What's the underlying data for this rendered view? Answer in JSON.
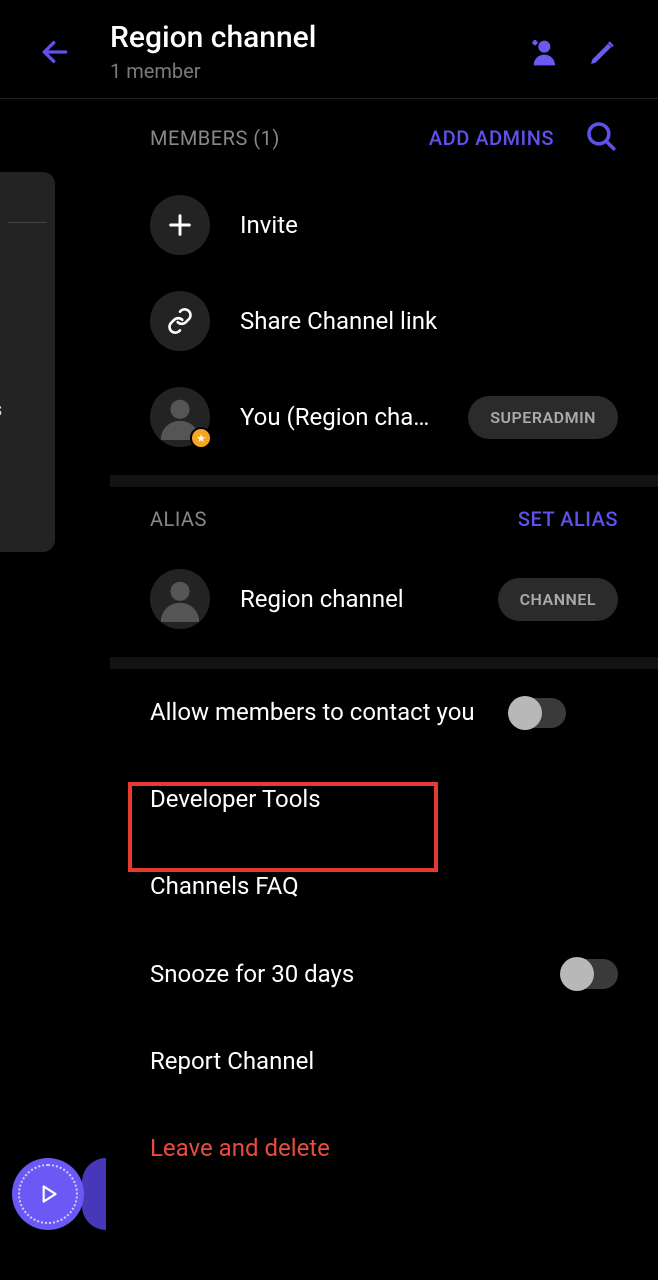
{
  "header": {
    "title": "Region channel",
    "subtitle": "1 member"
  },
  "members_section": {
    "label": "MEMBERS (1)",
    "action": "ADD ADMINS",
    "invite": "Invite",
    "share": "Share Channel link",
    "you": "You (Region cha…",
    "you_badge": "SUPERADMIN"
  },
  "alias_section": {
    "label": "ALIAS",
    "action": "SET ALIAS",
    "name": "Region channel",
    "badge": "CHANNEL"
  },
  "options": {
    "allow_contact": "Allow members to contact you",
    "dev_tools": "Developer Tools",
    "faq": "Channels FAQ",
    "snooze": "Snooze for 30 days",
    "report": "Report Channel",
    "leave": "Leave and delete"
  },
  "side_letter": "s",
  "colors": {
    "accent": "#6050ec",
    "danger": "#e94b3c"
  }
}
